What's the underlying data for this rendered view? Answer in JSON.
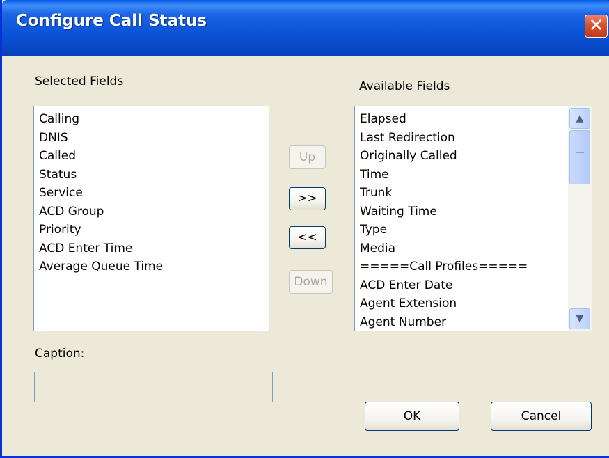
{
  "window": {
    "title": "Configure Call Status",
    "close_glyph": "✕"
  },
  "selected": {
    "label": "Selected Fields",
    "items": [
      "Calling",
      "DNIS",
      "Called",
      "Status",
      "Service",
      "ACD Group",
      "Priority",
      "ACD Enter Time",
      "Average Queue Time"
    ]
  },
  "available": {
    "label": "Available Fields",
    "items": [
      "Elapsed",
      "Last Redirection",
      "Originally Called",
      "Time",
      "Trunk",
      "Waiting Time",
      "Type",
      "Media",
      "=====Call Profiles=====",
      "ACD Enter Date",
      "Agent Extension",
      "Agent Number"
    ],
    "scroll_up_icon": "▲",
    "scroll_down_icon": "▼"
  },
  "buttons": {
    "up": "Up",
    "add": ">>",
    "remove": "<<",
    "down": "Down",
    "ok": "OK",
    "cancel": "Cancel"
  },
  "caption": {
    "label": "Caption:",
    "value": ""
  },
  "colors": {
    "title_bar": "#0a53d6",
    "dialog_bg": "#ece9d8",
    "close_button": "#d6532f",
    "list_border": "#7f9db9",
    "button_border": "#003c74",
    "disabled_text": "#aca899"
  }
}
